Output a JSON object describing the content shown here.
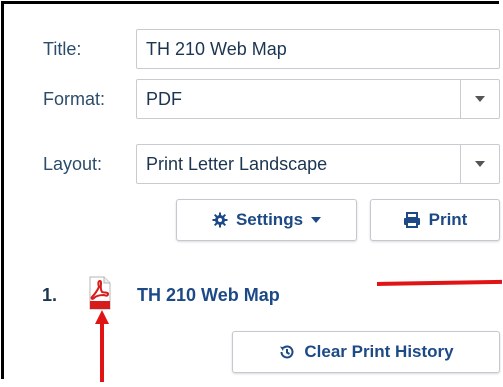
{
  "form": {
    "title_label": "Title:",
    "title_value": "TH 210 Web Map",
    "format_label": "Format:",
    "format_value": "PDF",
    "layout_label": "Layout:",
    "layout_value": "Print Letter Landscape"
  },
  "buttons": {
    "settings_label": "Settings",
    "print_label": "Print",
    "clear_history_label": "Clear Print History"
  },
  "history": {
    "items": [
      {
        "number": "1.",
        "title": "TH 210 Web Map"
      }
    ]
  },
  "icons": {
    "settings": "gear-icon",
    "settings_dropdown": "caret-down-icon",
    "print": "printer-icon",
    "history_item": "pdf-file-icon",
    "clear_history": "history-icon",
    "select_dropdown": "chevron-down-icon"
  },
  "colors": {
    "link_blue": "#1d4a86",
    "annotation_red": "#e01414",
    "pdf_red": "#d71c1c"
  }
}
